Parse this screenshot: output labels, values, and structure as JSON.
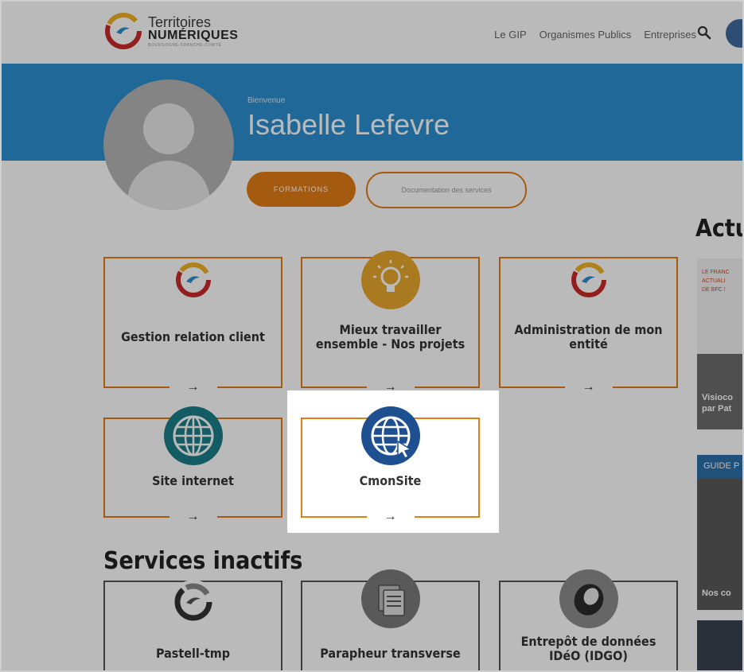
{
  "header": {
    "logo": {
      "line1": "Territoires",
      "line2": "NUMÉRIQUES",
      "line3": "BOURGOGNE-FRANCHE-COMTÉ"
    },
    "nav": [
      "Le GIP",
      "Organismes Publics",
      "Entreprises"
    ],
    "icons": {
      "search": "search-icon",
      "account": "user-menu-icon"
    }
  },
  "profile": {
    "welcome": "Bienvenue",
    "name": "Isabelle Lefevre",
    "buttons": {
      "formations": "FORMATIONS",
      "documentation": "Documentation des services"
    }
  },
  "services": [
    {
      "label": "Gestion relation client",
      "icon": "tn-logo-icon",
      "arrow": "→"
    },
    {
      "label": "Mieux travailler ensemble - Nos projets",
      "icon": "lightbulb-icon",
      "arrow": "→"
    },
    {
      "label": "Administration de mon entité",
      "icon": "tn-logo-icon",
      "arrow": "→"
    },
    {
      "label": "Site internet",
      "icon": "globe-icon",
      "arrow": "→"
    },
    {
      "label": "CmonSite",
      "icon": "globe-cursor-icon",
      "arrow": "→"
    }
  ],
  "inactive": {
    "title": "Services inactifs",
    "items": [
      {
        "label": "Pastell-tmp",
        "icon": "pastell-icon"
      },
      {
        "label": "Parapheur transverse",
        "icon": "document-stack-icon"
      },
      {
        "label": "Entrepôt de données IDéO (IDGO)",
        "icon": "ideo-icon"
      }
    ]
  },
  "news": {
    "title": "Actu",
    "item1": {
      "lines": [
        "LE FRANC",
        "ACTUALI",
        "DE BFC !"
      ],
      "caption": "Visioco\npar Pat"
    },
    "item2": {
      "band": "GUIDE P",
      "caption": "Nos co"
    }
  },
  "colors": {
    "accent": "#e37d15",
    "banner": "#2b8fcf",
    "overlay": "rgba(0,0,0,0.27)"
  }
}
